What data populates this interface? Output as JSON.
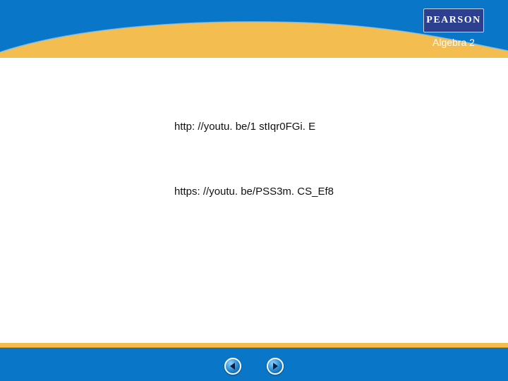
{
  "header": {
    "brand_logo_text": "PEARSON",
    "subject_title": "Algebra 2"
  },
  "content": {
    "links": [
      "http: //youtu. be/1 stIqr0FGi. E",
      "https: //youtu. be/PSS3m. CS_Ef8"
    ]
  },
  "footer": {
    "prev_icon": "triangle-left-icon",
    "next_icon": "triangle-right-icon"
  },
  "colors": {
    "header_blue": "#0a76c7",
    "accent_gold": "#f3bd4f",
    "logo_navy": "#2d3f8f",
    "background": "#ffffff"
  }
}
